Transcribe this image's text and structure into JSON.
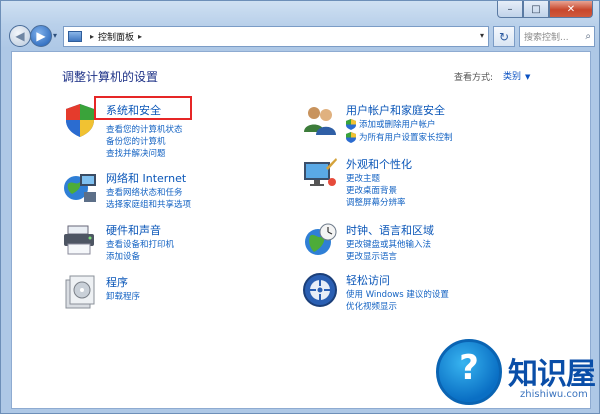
{
  "window": {
    "caption_min": "–",
    "caption_max": "□",
    "caption_close": "✕"
  },
  "toolbar": {
    "back_glyph": "◀",
    "forward_glyph": "▶",
    "history_glyph": "▾",
    "breadcrumb_sep1": "▸",
    "breadcrumb_label": "控制面板",
    "breadcrumb_sep2": "▸",
    "address_dropdown": "▾",
    "refresh_glyph": "↻",
    "search_placeholder": "搜索控制...",
    "search_icon_glyph": "⌕"
  },
  "header": {
    "title": "调整计算机的设置",
    "view_by_label": "查看方式:",
    "view_mode": "类别",
    "view_mode_arrow": "▼"
  },
  "categories": [
    {
      "title": "系统和安全",
      "icon": "system-security-icon",
      "links": [
        "查看您的计算机状态",
        "备份您的计算机",
        "查找并解决问题"
      ]
    },
    {
      "title": "网络和 Internet",
      "icon": "network-internet-icon",
      "links": [
        "查看网络状态和任务",
        "选择家庭组和共享选项"
      ]
    },
    {
      "title": "硬件和声音",
      "icon": "hardware-sound-icon",
      "links": [
        "查看设备和打印机",
        "添加设备"
      ]
    },
    {
      "title": "程序",
      "icon": "programs-icon",
      "links": [
        "卸载程序"
      ]
    },
    {
      "title": "用户帐户和家庭安全",
      "icon": "user-accounts-icon",
      "links": [
        "添加或删除用户帐户",
        "为所有用户设置家长控制"
      ]
    },
    {
      "title": "外观和个性化",
      "icon": "appearance-icon",
      "links": [
        "更改主题",
        "更改桌面背景",
        "调整屏幕分辨率"
      ]
    },
    {
      "title": "时钟、语言和区域",
      "icon": "clock-language-icon",
      "links": [
        "更改键盘或其他输入法",
        "更改显示语言"
      ]
    },
    {
      "title": "轻松访问",
      "icon": "ease-of-access-icon",
      "links": [
        "使用 Windows 建议的设置",
        "优化视频显示"
      ]
    }
  ],
  "watermark": {
    "text": "知识屋",
    "sub": "zhishiwu.com",
    "glyph": "?"
  },
  "colors": {
    "link": "#1463c3",
    "title": "#1e3287",
    "highlight": "#e62626",
    "frame": "#b9d0ea"
  }
}
